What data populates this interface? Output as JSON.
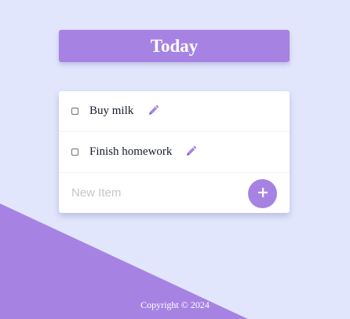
{
  "colors": {
    "background": "#e1e6fd",
    "accent": "#a683e3",
    "card": "#ffffff",
    "text": "#151b2c"
  },
  "heading": {
    "title": "Today"
  },
  "todo": {
    "items": [
      {
        "label": "Buy milk",
        "checked": false,
        "edit_icon": "pencil-icon"
      },
      {
        "label": "Finish homework",
        "checked": false,
        "edit_icon": "pencil-icon"
      }
    ],
    "new_item": {
      "placeholder": "New Item",
      "value": ""
    },
    "add_button": {
      "icon": "plus-icon",
      "label": "+"
    }
  },
  "footer": {
    "copyright": "Copyright © 2024"
  }
}
